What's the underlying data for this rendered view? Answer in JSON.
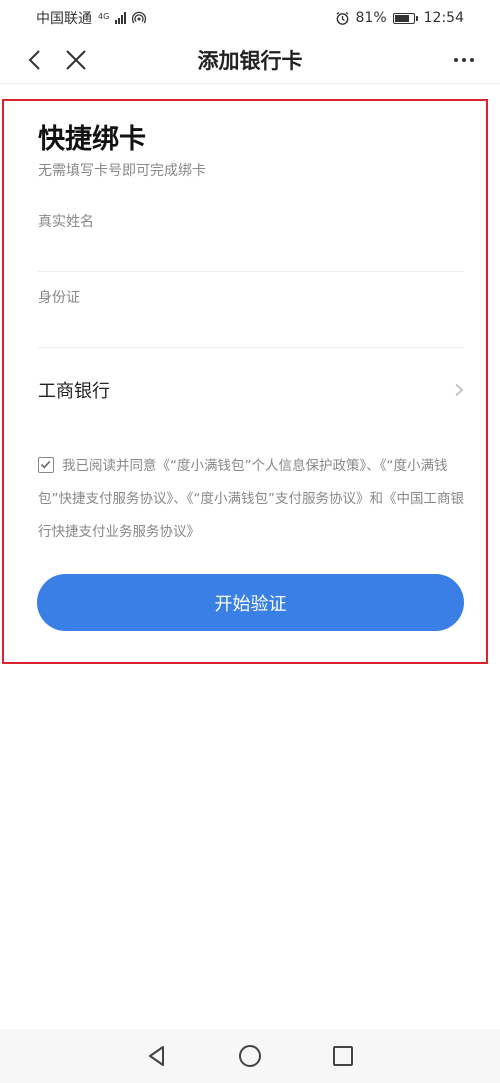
{
  "status_bar": {
    "carrier": "中国联通",
    "network": "4G",
    "battery": "81%",
    "battery_level": 0.81,
    "time": "12:54"
  },
  "nav": {
    "title": "添加银行卡",
    "back_icon": "chevron-left-icon",
    "close_icon": "close-icon",
    "more_icon": "more-horizontal-icon"
  },
  "form": {
    "title": "快捷绑卡",
    "subtitle": "无需填写卡号即可完成绑卡",
    "name_label": "真实姓名",
    "name_value": "",
    "id_label": "身份证",
    "id_value": "",
    "bank_name": "工商银行"
  },
  "agreement": {
    "checked": true,
    "text": "我已阅读并同意《“度小满钱包”个人信息保护政策》、《“度小满钱包”快捷支付服务协议》、《“度小满钱包”支付服务协议》和《中国工商银行快捷支付业务服务协议》"
  },
  "actions": {
    "verify_label": "开始验证"
  },
  "colors": {
    "primary": "#3a7fe6",
    "highlight_frame": "#d9232d"
  }
}
